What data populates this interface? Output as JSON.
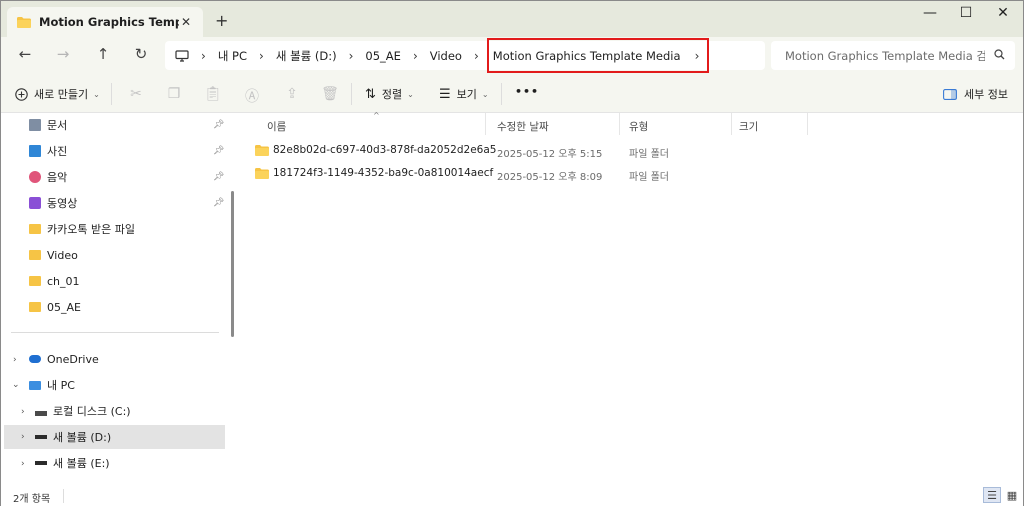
{
  "tab": {
    "title": "Motion Graphics Template M",
    "close": "✕",
    "new_tab": "+"
  },
  "window_controls": {
    "minimize": "—",
    "maximize": "☐",
    "close": "✕"
  },
  "nav": {
    "back": "←",
    "forward": "→",
    "up": "↑",
    "refresh": "↻"
  },
  "breadcrumbs": [
    "내 PC",
    "새 볼륨 (D:)",
    "05_AE",
    "Video"
  ],
  "breadcrumb_current": "Motion Graphics Template Media",
  "search": {
    "placeholder": "Motion Graphics Template Media 검색"
  },
  "toolbar": {
    "new_label": "새로 만들기",
    "sort_label": "정렬",
    "view_label": "보기",
    "more": "•••",
    "details_label": "세부 정보"
  },
  "sidebar": {
    "quick": [
      {
        "label": "문서",
        "icon": "document-icon",
        "pinned": true
      },
      {
        "label": "사진",
        "icon": "pictures-icon",
        "pinned": true
      },
      {
        "label": "음악",
        "icon": "music-icon",
        "pinned": true
      },
      {
        "label": "동영상",
        "icon": "videos-icon",
        "pinned": true
      },
      {
        "label": "카카오톡 받은 파일",
        "icon": "folder-icon",
        "pinned": false
      },
      {
        "label": "Video",
        "icon": "folder-icon",
        "pinned": false
      },
      {
        "label": "ch_01",
        "icon": "folder-icon",
        "pinned": false
      },
      {
        "label": "05_AE",
        "icon": "folder-icon",
        "pinned": false
      }
    ],
    "tree": [
      {
        "label": "OneDrive",
        "icon": "onedrive-icon"
      },
      {
        "label": "내 PC",
        "icon": "pc-icon"
      },
      {
        "label": "로컬 디스크 (C:)",
        "icon": "drive-icon"
      },
      {
        "label": "새 볼륨 (D:)",
        "icon": "drive-icon"
      },
      {
        "label": "새 볼륨 (E:)",
        "icon": "drive-icon"
      }
    ]
  },
  "columns": {
    "name": "이름",
    "modified": "수정한 날짜",
    "type": "유형",
    "size": "크기"
  },
  "files": [
    {
      "name": "82e8b02d-c697-40d3-878f-da2052d2e6a5",
      "modified": "2025-05-12 오후 5:15",
      "type": "파일 폴더"
    },
    {
      "name": "181724f3-1149-4352-ba9c-0a810014aecf",
      "modified": "2025-05-12 오후 8:09",
      "type": "파일 폴더"
    }
  ],
  "status": {
    "item_count": "2개 항목"
  },
  "colors": {
    "folder": "#f6c445",
    "highlight_box": "#e21b1b",
    "title_bar": "#e6e9dd",
    "toolbar": "#f5f6f0"
  }
}
